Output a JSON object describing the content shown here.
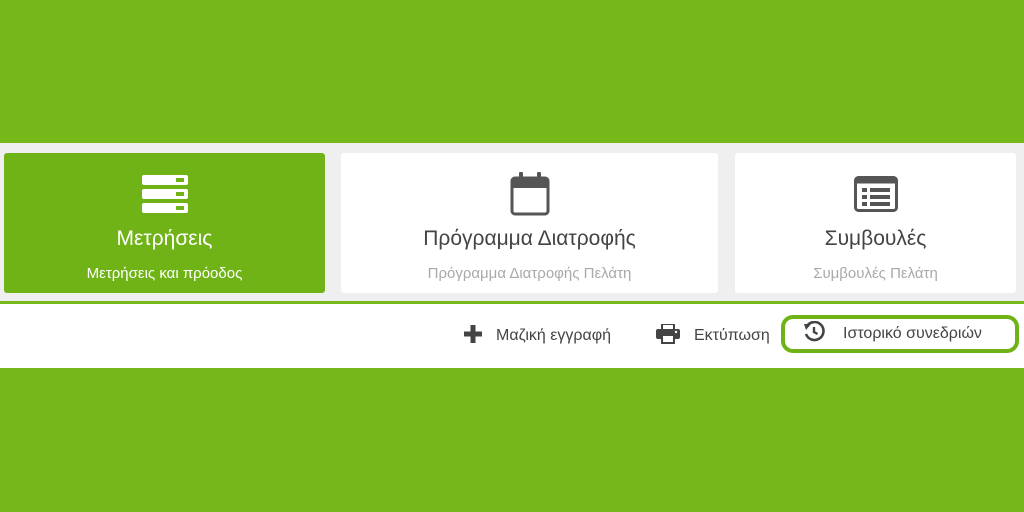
{
  "cards": [
    {
      "title": "Μετρήσεις",
      "subtitle": "Μετρήσεις και πρόοδος",
      "icon": "server-stack-icon",
      "active": true
    },
    {
      "title": "Πρόγραμμα Διατροφής",
      "subtitle": "Πρόγραμμα Διατροφής Πελάτη",
      "icon": "calendar-icon",
      "active": false
    },
    {
      "title": "Συμβουλές",
      "subtitle": "Συμβουλές Πελάτη",
      "icon": "list-card-icon",
      "active": false
    }
  ],
  "toolbar": {
    "bulk_entry_label": "Μαζική εγγραφή",
    "print_label": "Εκτύπωση",
    "history_label": "Ιστορικό συνεδριών"
  },
  "colors": {
    "brand_green": "#76b71a",
    "active_card": "#6fb317",
    "text_dark": "#444444",
    "text_muted": "#a9a9a9"
  }
}
